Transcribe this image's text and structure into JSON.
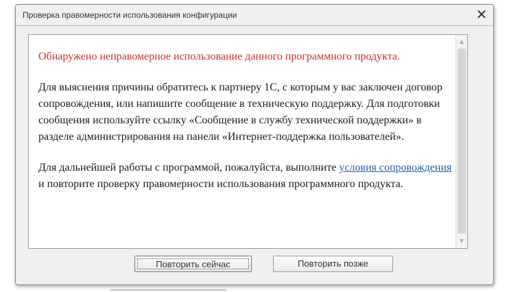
{
  "dialog": {
    "title": "Проверка правомерности использования конфигурации",
    "close_glyph": "✕"
  },
  "content": {
    "warning": "Обнаружено неправомерное использование данного программного продукта.",
    "paragraph1": "Для выяснения причины обратитесь к партнеру 1С, с которым у вас заключен договор сопровождения, или напишите сообщение в техническую поддержку. Для подготовки сообщения используйте ссылку «Сообщение в службу технической поддержки» в разделе администрирования на панели «Интернет-поддержка пользователей».",
    "paragraph2_before": "Для дальнейшей работы с программой, пожалуйста, выполните",
    "paragraph2_link": "условия сопровождения",
    "paragraph2_after": "и повторите проверку правомерности использования программного продукта."
  },
  "scrollbar": {
    "up_glyph": "▲",
    "down_glyph": "▼"
  },
  "buttons": {
    "retry_now": "Повторить сейчас",
    "retry_later": "Повторить позже"
  },
  "colors": {
    "warning": "#c8302a",
    "link": "#1f5fa8",
    "dialog_bg": "#f0f0f0"
  }
}
